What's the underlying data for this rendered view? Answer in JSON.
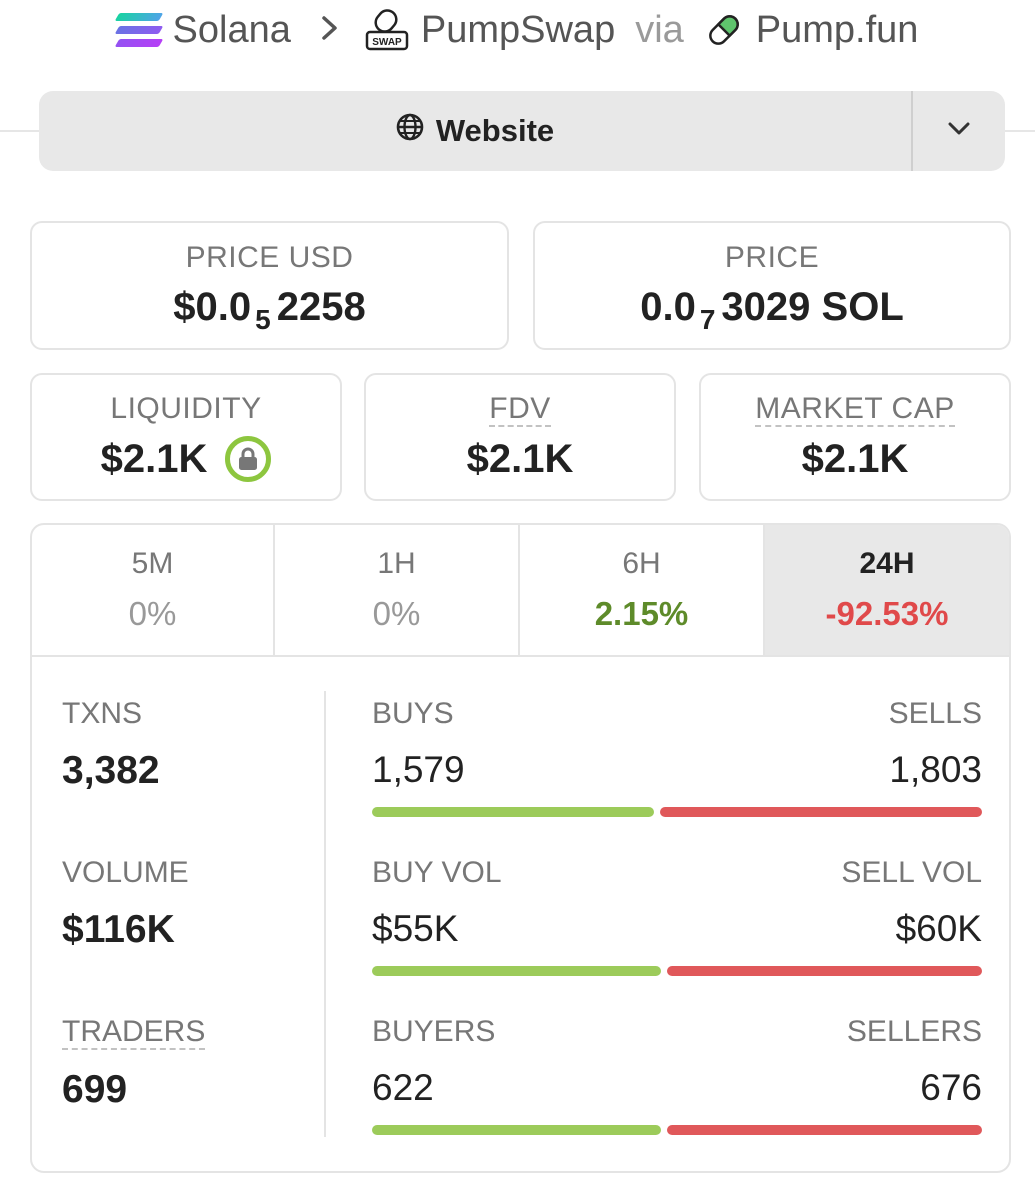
{
  "breadcrumb": {
    "chain": "Solana",
    "separator": ">",
    "dex": "PumpSwap",
    "dex_badge": "SWAP",
    "via": "via",
    "launchpad": "Pump.fun"
  },
  "selector": {
    "label": "Website",
    "icon": "globe-icon",
    "dropdown_icon": "chevron-down-icon"
  },
  "prices": {
    "usd": {
      "label": "PRICE USD",
      "prefix": "$0.0",
      "zeros_subscript": "5",
      "digits": "2258"
    },
    "native": {
      "label": "PRICE",
      "prefix": "0.0",
      "zeros_subscript": "7",
      "digits": "3029 SOL"
    }
  },
  "metrics": {
    "liquidity": {
      "label": "LIQUIDITY",
      "value": "$2.1K",
      "icon": "lock-icon",
      "icon_color": "#8dc63f"
    },
    "fdv": {
      "label": "FDV",
      "value": "$2.1K"
    },
    "market_cap": {
      "label": "MARKET CAP",
      "value": "$2.1K"
    }
  },
  "tabs": [
    {
      "label": "5M",
      "change": "0%",
      "trend": "neutral"
    },
    {
      "label": "1H",
      "change": "0%",
      "trend": "neutral"
    },
    {
      "label": "6H",
      "change": "2.15%",
      "trend": "positive"
    },
    {
      "label": "24H",
      "change": "-92.53%",
      "trend": "negative",
      "active": true
    }
  ],
  "stats": {
    "txns": {
      "label": "TXNS",
      "value": "3,382"
    },
    "volume": {
      "label": "VOLUME",
      "value": "$116K"
    },
    "traders": {
      "label": "TRADERS",
      "value": "699"
    },
    "buys_sells": {
      "buy_label": "BUYS",
      "sell_label": "SELLS",
      "buy_value": "1,579",
      "sell_value": "1,803",
      "buy_fraction": 0.467
    },
    "buy_sell_vol": {
      "buy_label": "BUY VOL",
      "sell_label": "SELL VOL",
      "buy_value": "$55K",
      "sell_value": "$60K",
      "buy_fraction": 0.478
    },
    "buyers_sellers": {
      "buy_label": "BUYERS",
      "sell_label": "SELLERS",
      "buy_value": "622",
      "sell_value": "676",
      "buy_fraction": 0.479
    }
  },
  "colors": {
    "positive": "#5e8b2a",
    "negative": "#e0494a",
    "buy_bar": "#9ccb5a",
    "sell_bar": "#e0585a"
  }
}
